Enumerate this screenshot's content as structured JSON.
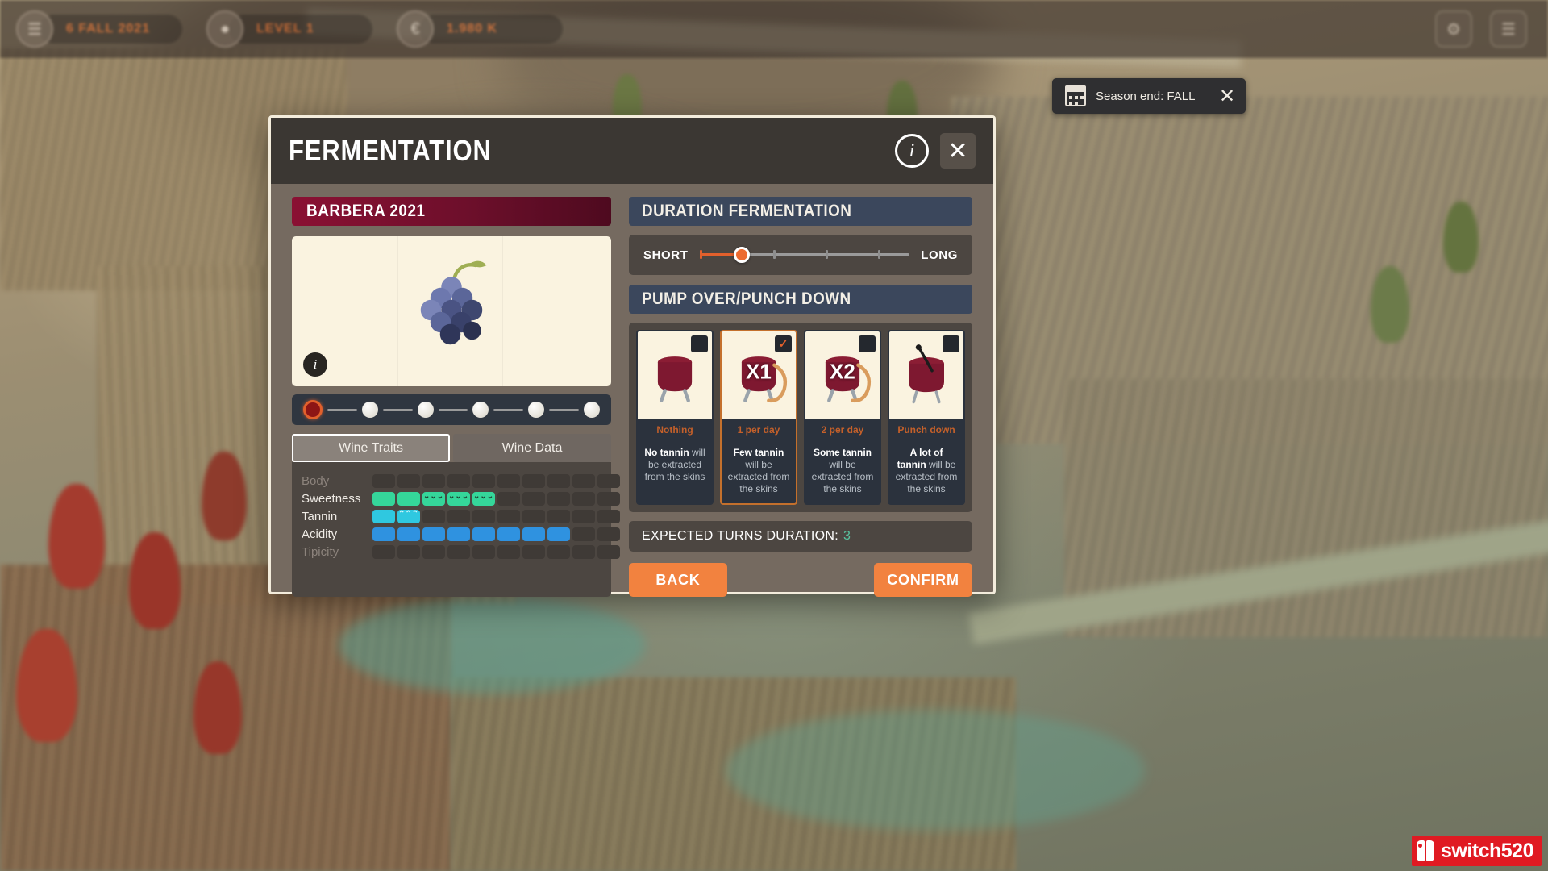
{
  "hud": {
    "chips": [
      {
        "icon": "calendar-icon",
        "label": "6 FALL 2021"
      },
      {
        "icon": "trophy-icon",
        "label": "LEVEL 1"
      },
      {
        "icon": "money-icon",
        "label": "1.980 K"
      }
    ],
    "right_buttons": [
      {
        "icon": "settings-icon",
        "glyph": "⚙"
      },
      {
        "icon": "menu-icon",
        "glyph": "☰"
      }
    ]
  },
  "toast": {
    "icon": "calendar-icon",
    "text": "Season end: FALL",
    "close_label": "✕"
  },
  "modal": {
    "title": "FERMENTATION",
    "info_label": "i",
    "close_label": "✕",
    "left": {
      "wine_name": "BARBERA 2021",
      "grape_info_label": "i",
      "stage_count": 6,
      "stage_active_index": 0,
      "tabs": [
        {
          "label": "Wine Traits",
          "active": true
        },
        {
          "label": "Wine Data",
          "active": false
        }
      ],
      "traits": [
        {
          "name": "Body",
          "dim": true,
          "filled": 0,
          "total": 10,
          "color_key": "body",
          "marks": 0
        },
        {
          "name": "Sweetness",
          "dim": false,
          "filled": 5,
          "total": 10,
          "color_key": "sweet",
          "marks": 3
        },
        {
          "name": "Tannin",
          "dim": false,
          "filled": 2,
          "total": 10,
          "color_key": "tannin",
          "marks": 1
        },
        {
          "name": "Acidity",
          "dim": false,
          "filled": 8,
          "total": 10,
          "color_key": "acid",
          "marks": 0
        },
        {
          "name": "Tipicity",
          "dim": true,
          "filled": 0,
          "total": 10,
          "color_key": "tip",
          "marks": 0
        }
      ]
    },
    "right": {
      "duration_title": "DURATION FERMENTATION",
      "slider": {
        "min_label": "SHORT",
        "max_label": "LONG",
        "value": 1,
        "steps": 5,
        "ticks": 5
      },
      "pump_title": "PUMP OVER/PUNCH DOWN",
      "cards": [
        {
          "id": "nothing",
          "title": "Nothing",
          "badge": "",
          "checked": false,
          "selected": false,
          "desc_strong": "No tannin",
          "desc_rest": " will be extracted from the skins"
        },
        {
          "id": "one-per-day",
          "title": "1 per day",
          "badge": "X1",
          "checked": true,
          "selected": true,
          "desc_strong": "Few tannin",
          "desc_rest": " will be extracted from the skins"
        },
        {
          "id": "two-per-day",
          "title": "2 per day",
          "badge": "X2",
          "checked": false,
          "selected": false,
          "desc_strong": "Some tannin",
          "desc_rest": " will be extracted from the skins"
        },
        {
          "id": "punch-down",
          "title": "Punch down",
          "badge": "",
          "checked": false,
          "selected": false,
          "desc_strong": "A lot of tannin",
          "desc_rest": " will be extracted from the skins"
        }
      ],
      "turns_label": "EXPECTED TURNS DURATION:",
      "turns_value": "3",
      "back_label": "BACK",
      "confirm_label": "CONFIRM"
    }
  },
  "watermark": {
    "text": "switch520"
  },
  "colors": {
    "accent_orange": "#f2823f",
    "wine_red": "#6d0f2b",
    "sweet": "#35d69a",
    "tannin": "#2fc8e0",
    "acid": "#2f92e0",
    "panel_dark": "#2b323d",
    "panel_mid": "#4c4641",
    "header_dark": "#3b3733"
  }
}
